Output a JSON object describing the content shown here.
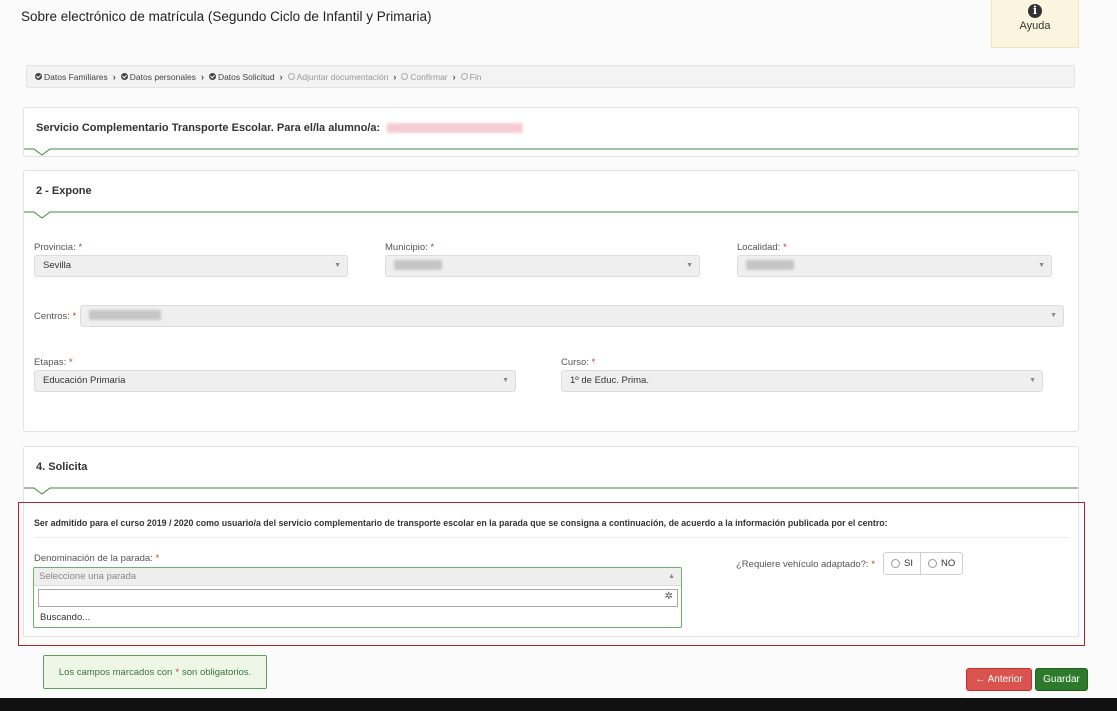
{
  "header": {
    "title": "Sobre electrónico de matrícula (Segundo Ciclo de Infantil y Primaria)",
    "help_icon": "info-icon",
    "help_label": "Ayuda"
  },
  "steps": [
    {
      "label": "Datos Familiares",
      "state": "done"
    },
    {
      "label": "Datos personales",
      "state": "done"
    },
    {
      "label": "Datos Solicitud",
      "state": "done"
    },
    {
      "label": "Adjuntar documentación",
      "state": "pending"
    },
    {
      "label": "Confirmar",
      "state": "pending"
    },
    {
      "label": "Fin",
      "state": "pending"
    }
  ],
  "student_panel": {
    "title": "Servicio Complementario Transporte Escolar. Para el/la alumno/a:"
  },
  "expone": {
    "title": "2 - Expone",
    "required_mark": "*",
    "provincia": {
      "label": "Provincia:",
      "value": "Sevilla"
    },
    "municipio": {
      "label": "Municipio:"
    },
    "localidad": {
      "label": "Localidad:"
    },
    "centros": {
      "label": "Centros:"
    },
    "etapas": {
      "label": "Etapas:",
      "value": "Educación Primaria"
    },
    "curso": {
      "label": "Curso:",
      "value": "1º de Educ. Prima."
    }
  },
  "solicita": {
    "title": "4. Solicita",
    "statement": "Ser admitido para el curso 2019 / 2020 como usuario/a del servicio complementario de transporte escolar en la parada que se consigna a continuación, de acuerdo a la información publicada por el centro:",
    "parada_label": "Denominación de la parada:",
    "parada_placeholder": "Seleccione una parada",
    "search_value": "",
    "searching_text": "Buscando...",
    "adaptado_label": "¿Requiere vehículo adaptado?:",
    "options": [
      "SI",
      "NO"
    ]
  },
  "footer": {
    "note_before": "Los campos marcados con",
    "note_mark": "*",
    "note_after": "son obligatorios.",
    "prev_label": "← Anterior",
    "save_label": "Guardar"
  },
  "colors": {
    "accent_green": "#2d7a2d",
    "danger_red": "#d9534f",
    "highlight_border": "#b0212a"
  }
}
